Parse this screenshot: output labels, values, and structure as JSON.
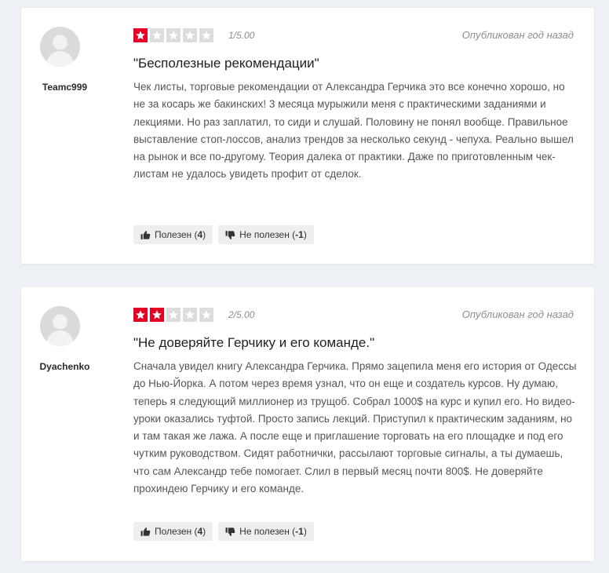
{
  "reviews": [
    {
      "author": "Teamc999",
      "rating": 1,
      "score_text": "1/5.00",
      "published": "Опубликован год назад",
      "title": "\"Бесполезные рекомендации\"",
      "text": "Чек листы, торговые рекомендации от Александра Герчика это все конечно хорошо, но не за косарь же бакинских! 3 месяца мурыжили меня с практическими заданиями и лекциями. Но раз заплатил, то сиди и слушай. Половину не понял вообще. Правильное выставление стоп-лоссов, анализ трендов за несколько секунд - чепуха. Реально вышел на рынок и все по-другому. Теория далека от практики. Даже по приготовленным чек-листам не удалось увидеть профит от сделок.",
      "helpful_label": "Полезен",
      "helpful_count": "4",
      "unhelpful_label": "Не полезен",
      "unhelpful_count": "-1"
    },
    {
      "author": "Dyachenko",
      "rating": 2,
      "score_text": "2/5.00",
      "published": "Опубликован год назад",
      "title": "\"Не доверяйте Герчику и его команде.\"",
      "text": "Сначала увидел книгу Александра Герчика. Прямо зацепила меня его история от Одессы до Нью-Йорка. А потом через время узнал, что он еще и создатель курсов. Ну думаю, теперь я следующий миллионер из трущоб. Собрал 1000$ на курс и купил его. Но видео-уроки оказались туфтой. Просто запись лекций. Приступил к практическим заданиям, но и там такая же лажа. А после еще и приглашение торговать на его площадке и под его чутким руководством. Сидят работнички, рассылают торговые сигналы, а ты думаешь, что сам Александр тебе помогает. Слил в первый месяц почти 800$. Не доверяйте прохиндею Герчику и его команде.",
      "helpful_label": "Полезен",
      "helpful_count": "4",
      "unhelpful_label": "Не полезен",
      "unhelpful_count": "-1"
    }
  ],
  "colors": {
    "star_active": "#e60023",
    "star_inactive": "#dcdcdc",
    "page_background": "#edf0f4"
  }
}
